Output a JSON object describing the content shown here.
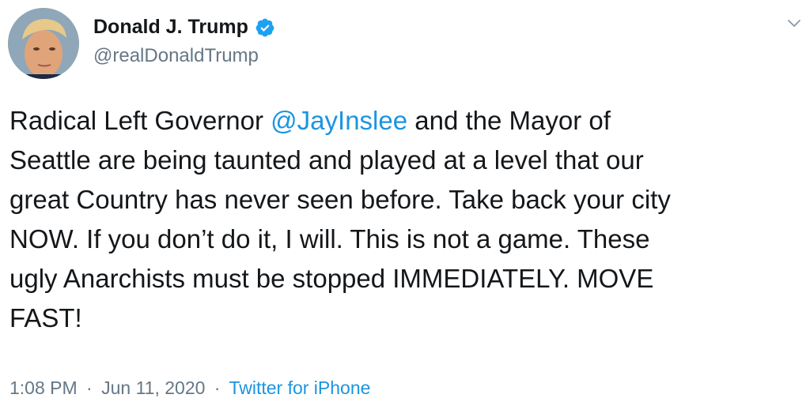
{
  "author": {
    "name": "Donald J. Trump",
    "handle": "@realDonaldTrump",
    "verified": true
  },
  "tweet": {
    "lines": [
      {
        "pre": "Radical Left Governor ",
        "mention": "@JayInslee",
        "post": " and the Mayor of"
      },
      {
        "text": "Seattle are being taunted and played at a level that our"
      },
      {
        "text": "great Country has never seen before. Take back your city"
      },
      {
        "text": "NOW. If you don’t do it, I will. This is not a game. These"
      },
      {
        "text": "ugly Anarchists must be stopped IMMEDIATELY. MOVE"
      },
      {
        "text": "FAST!"
      }
    ]
  },
  "meta": {
    "time": "1:08 PM",
    "separator": "·",
    "date": "Jun 11, 2020",
    "source": "Twitter for iPhone"
  },
  "icons": {
    "verified": "verified-badge-icon",
    "more": "chevron-down-icon"
  },
  "colors": {
    "accent": "#1b95e0",
    "text": "#14171a",
    "muted": "#657786"
  }
}
